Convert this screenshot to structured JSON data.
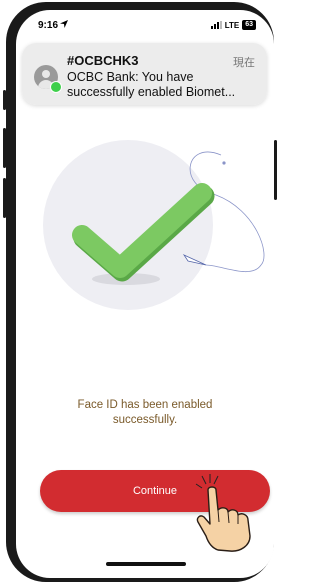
{
  "status_bar": {
    "time": "9:16",
    "network": "LTE",
    "battery": "63"
  },
  "notification": {
    "title": "#OCBCHK3",
    "time": "現在",
    "line1": "OCBC Bank: You have",
    "line2": "successfully enabled Biomet..."
  },
  "main": {
    "message_line1": "Face ID has been enabled",
    "message_line2": "successfully.",
    "continue_label": "Continue"
  },
  "colors": {
    "accent_red": "#d22c30",
    "check_green": "#7cc962",
    "message_brown": "#7a5a2a"
  }
}
